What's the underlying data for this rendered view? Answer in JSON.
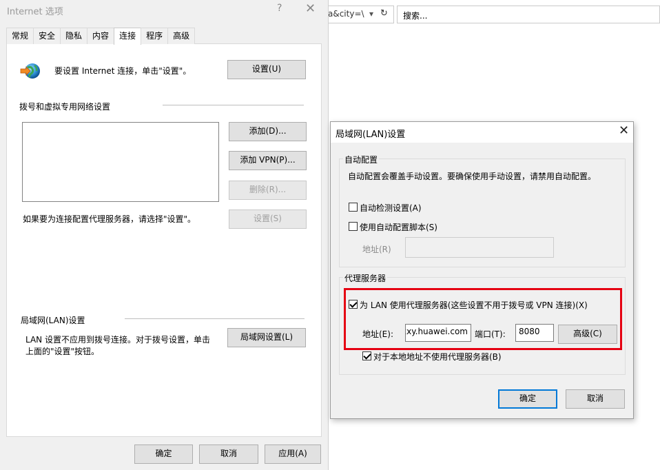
{
  "browser": {
    "address_fragment": "a&city=\\",
    "dropdown_glyph": "▾",
    "refresh_glyph": "↻",
    "search_placeholder": "搜索..."
  },
  "internet_options": {
    "title": "Internet 选项",
    "help_glyph": "?",
    "close_glyph": "✕",
    "tabs": [
      "常规",
      "安全",
      "隐私",
      "内容",
      "连接",
      "程序",
      "高级"
    ],
    "active_tab": "连接",
    "setup_text": "要设置 Internet 连接，单击\"设置\"。",
    "setup_button": "设置(U)",
    "dialup_section": "拨号和虚拟专用网络设置",
    "add_button": "添加(D)...",
    "add_vpn_button": "添加 VPN(P)...",
    "remove_button": "删除(R)...",
    "settings_button": "设置(S)",
    "proxy_hint": "如果要为连接配置代理服务器，请选择\"设置\"。",
    "lan_section": "局域网(LAN)设置",
    "lan_hint_1": "LAN 设置不应用到拨号连接。对于拨号设置，单击",
    "lan_hint_2": "上面的\"设置\"按钮。",
    "lan_button": "局域网设置(L)",
    "ok": "确定",
    "cancel": "取消",
    "apply": "应用(A)"
  },
  "lan_dialog": {
    "title": "局域网(LAN)设置",
    "close_glyph": "✕",
    "auto_group": "自动配置",
    "auto_desc": "自动配置会覆盖手动设置。要确保使用手动设置，请禁用自动配置。",
    "auto_detect": {
      "label": "自动检测设置(A)",
      "checked": false
    },
    "auto_script": {
      "label": "使用自动配置脚本(S)",
      "checked": false
    },
    "script_address_label": "地址(R)",
    "script_address_value": "",
    "proxy_group": "代理服务器",
    "use_proxy": {
      "label": "为 LAN 使用代理服务器(这些设置不用于拨号或 VPN 连接)(X)",
      "checked": true
    },
    "address_label": "地址(E):",
    "address_value": "xxy.huawei.com",
    "port_label": "端口(T):",
    "port_value": "8080",
    "advanced_button": "高级(C)",
    "bypass_local": {
      "label": "对于本地地址不使用代理服务器(B)",
      "checked": true
    },
    "ok": "确定",
    "cancel": "取消",
    "highlight_color": "#e50012"
  }
}
